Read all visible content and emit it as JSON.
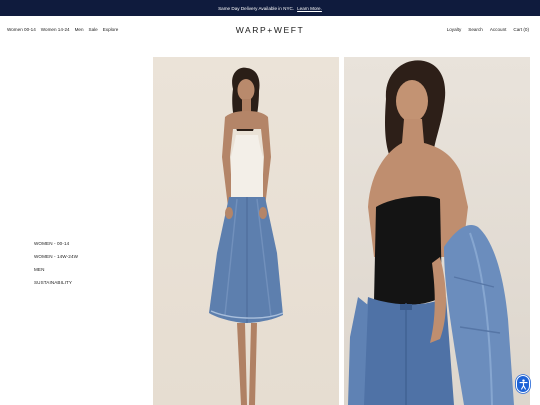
{
  "announcement": {
    "text": "Same Day Delivery Available in NYC.",
    "link": "Learn More."
  },
  "brand": {
    "logo": "WARP+WEFT"
  },
  "nav_left": [
    "Women 00-14",
    "Women 14-24",
    "Men",
    "Sale",
    "Explore"
  ],
  "nav_right": [
    "Loyalty",
    "Search",
    "Account",
    "Cart (0)"
  ],
  "side_menu": [
    "WOMEN - 00-14",
    "WOMEN - 14W-24W",
    "MEN",
    "SUSTAINABILITY"
  ],
  "colors": {
    "announcement_bg": "#0f1b3d",
    "accessibility_button": "#1e63d6"
  },
  "icons": {
    "accessibility": "accessibility-icon"
  },
  "photos": [
    {
      "name": "product-photo-denim-skirt"
    },
    {
      "name": "product-photo-black-tube-top"
    }
  ]
}
